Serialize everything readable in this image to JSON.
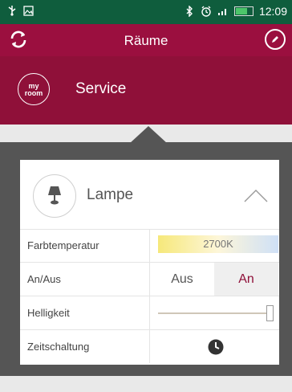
{
  "status_bar": {
    "time": "12:09",
    "icons": [
      "usb-icon",
      "image-icon",
      "bluetooth-icon",
      "alarm-icon",
      "signal-icon",
      "battery-icon"
    ]
  },
  "app_bar": {
    "title": "Räume",
    "left_icon": "refresh-icon",
    "right_icon": "edit-icon"
  },
  "room": {
    "logo_text_top": "my",
    "logo_text_bottom": "room",
    "name": "Service"
  },
  "device": {
    "name": "Lampe",
    "icon": "lamp-icon",
    "expanded": true
  },
  "rows": {
    "color_temp": {
      "label": "Farbtemperatur",
      "value": "2700K"
    },
    "power": {
      "label": "An/Aus",
      "off_label": "Aus",
      "on_label": "An",
      "selected": "An"
    },
    "brightness": {
      "label": "Helligkeit",
      "level": 1.0
    },
    "timer": {
      "label": "Zeitschaltung",
      "icon": "clock-icon"
    }
  },
  "colors": {
    "status_bar": "#0f5d3d",
    "app_bar": "#9b0f3f",
    "room_header": "#8f1039",
    "panel": "#555555",
    "accent": "#8f1039"
  }
}
